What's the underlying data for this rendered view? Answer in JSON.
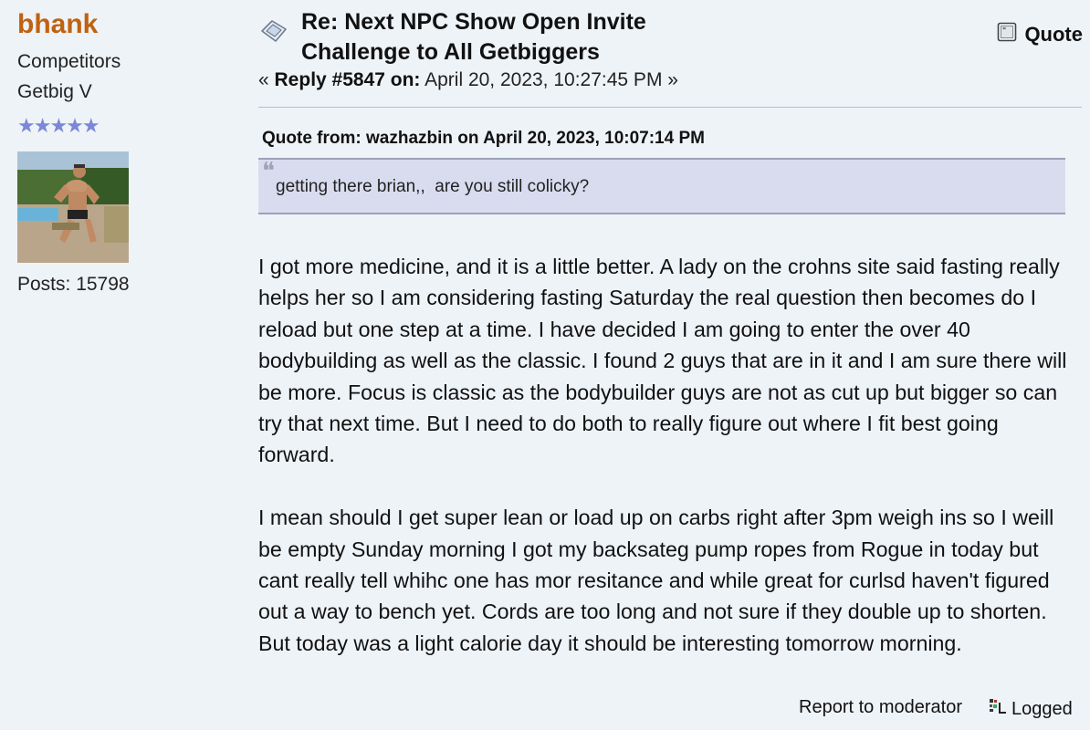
{
  "poster": {
    "name": "bhank",
    "group": "Competitors",
    "rank": "Getbig V",
    "stars": "★★★★★",
    "posts": "Posts: 15798",
    "colors": {
      "name": "#c0620f",
      "stars": "#7b88d8"
    }
  },
  "post": {
    "subject_line1": "Re: Next NPC Show Open Invite",
    "subject_line2": "Challenge to All Getbiggers",
    "reply_prefix": "« ",
    "reply_label": "Reply #5847 on:",
    "reply_date": " April 20, 2023, 10:27:45 PM »",
    "quote_button": "Quote",
    "quote": {
      "header": "Quote from: wazhazbin on April 20, 2023, 10:07:14 PM",
      "text": "getting there brian,,  are you still colicky?"
    },
    "paragraphs": [
      "I got more medicine, and it is a little better. A lady on the crohns site said fasting really helps her so I am considering fasting Saturday the real question then becomes do I reload but one step at a time. I have decided I am going to enter the over 40 bodybuilding as well as the classic. I found 2 guys that are in it and I am sure there will be more. Focus is classic as the bodybuilder guys are not as cut up but bigger so can try that next time. But I need to do both to really figure out where I fit best going forward.",
      "I mean should I get super lean or load up on carbs right after 3pm weigh ins so I weill be empty Sunday morning I got my backsateg pump ropes from Rogue in today but cant really tell whihc one has mor resitance and while great for curlsd haven't figured out a way to bench yet. Cords are too long and not sure if they double up to shorten. But today was a light calorie day it should be interesting tomorrow morning."
    ],
    "report_link": "Report to moderator",
    "logged": "Logged"
  },
  "icons": [
    "topic-icon",
    "quote-icon",
    "quote-mark-icon",
    "ip-logged-icon",
    "avatar"
  ],
  "colors": {
    "background": "#eef3f8",
    "quote_bg": "#d9dcef",
    "quote_border": "#9ba2b8"
  }
}
